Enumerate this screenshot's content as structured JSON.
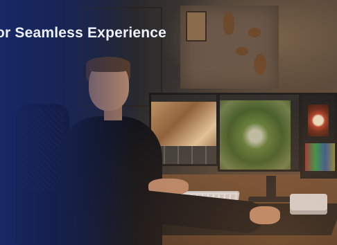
{
  "headline": {
    "text": "or Seamless Experience",
    "color": "#eef2ff"
  },
  "scene": {
    "overlay_color": "#182869",
    "desk_color": "#6a4a32"
  }
}
